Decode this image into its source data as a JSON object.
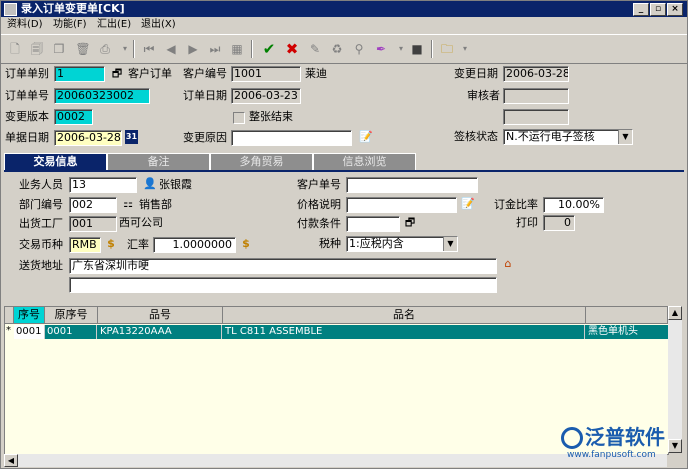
{
  "window": {
    "title": "录入订单变更单[CK]",
    "buttons": [
      "_",
      "▫",
      "×"
    ]
  },
  "menu": [
    "资料(D)",
    "功能(F)",
    "汇出(E)",
    "退出(X)"
  ],
  "header": {
    "order_type_label": "订单单别",
    "order_type_value": "1",
    "order_type_desc": "客户订单",
    "customer_no_label": "客户编号",
    "customer_no_value": "1001",
    "customer_name": "莱迪",
    "change_date_label": "变更日期",
    "change_date_value": "2006-03-28",
    "order_no_label": "订单单号",
    "order_no_value": "20060323002",
    "order_date_label": "订单日期",
    "order_date_value": "2006-03-23",
    "reviewer_label": "审核者",
    "reviewer_value": "",
    "extra_value": "",
    "version_label": "变更版本",
    "version_value": "0002",
    "whole_close_label": "整张结束",
    "doc_date_label": "单据日期",
    "doc_date_value": "2006-03-28",
    "calendar_icon_text": "31",
    "reason_label": "变更原因",
    "reason_value": "",
    "sign_status_label": "签核状态",
    "sign_status_value": "N.不运行电子签核"
  },
  "tabs": [
    "交易信息",
    "备注",
    "多角贸易",
    "信息浏览"
  ],
  "trade": {
    "salesman_label": "业务人员",
    "salesman_value": "13",
    "salesman_name": "张银霞",
    "customer_order_label": "客户单号",
    "customer_order_value": "",
    "dept_label": "部门编号",
    "dept_value": "002",
    "dept_name": "销售部",
    "price_desc_label": "价格说明",
    "price_desc_value": "",
    "deposit_label": "订金比率",
    "deposit_value": "10.00%",
    "factory_label": "出货工厂",
    "factory_value": "001",
    "factory_name": "西可公司",
    "payment_label": "付款条件",
    "payment_value": "",
    "print_label": "打印",
    "print_value": "0",
    "currency_label": "交易币种",
    "currency_value": "RMB",
    "rate_label": "汇率",
    "rate_value": "1.0000000",
    "tax_label": "税种",
    "tax_value": "1:应税内含",
    "address_label": "送货地址",
    "address_value": "广东省深圳市哽",
    "address_value2": ""
  },
  "grid": {
    "columns": [
      "序号",
      "原序号",
      "品号",
      "品名",
      ""
    ],
    "rows": [
      {
        "marker": "*",
        "seq": "0001",
        "orig_seq": "0001",
        "item_no": "KPA13220AAA",
        "item_name": "TL C811 ASSEMBLE",
        "spec": "黑色单机头"
      }
    ]
  },
  "brand": {
    "name": "泛普软件",
    "url": "www.fanpusoft.com"
  },
  "colors": {
    "title_bar": "#0a246a",
    "highlight_cyan": "#00d4d4",
    "selected_row": "#008080",
    "brand_blue": "#1a5cae"
  }
}
